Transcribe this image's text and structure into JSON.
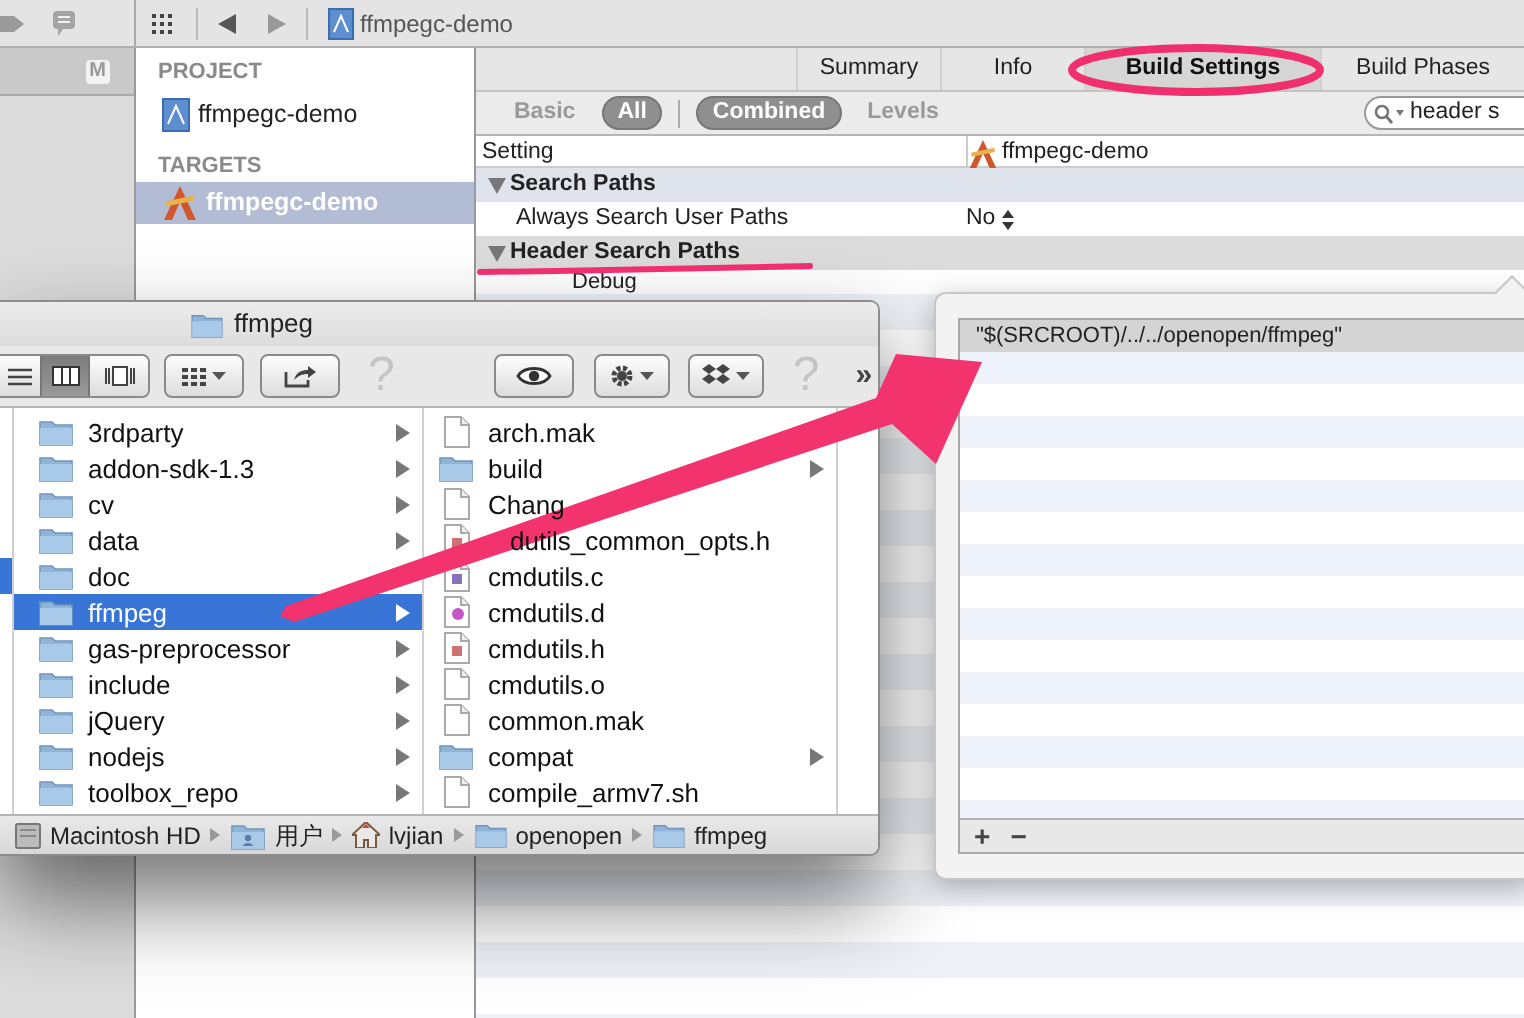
{
  "navigator": {
    "badge": "M"
  },
  "jump_bar": {
    "crumb": "ffmpegc-demo"
  },
  "project_list": [
    {
      "title": "PROJECT",
      "items": [
        {
          "label": "ffmpegc-demo",
          "kind": "project",
          "selected": false
        }
      ]
    },
    {
      "title": "TARGETS",
      "items": [
        {
          "label": "ffmpegc-demo",
          "kind": "target",
          "selected": true
        }
      ]
    }
  ],
  "editor_tabs": [
    {
      "label": "Summary",
      "selected": false
    },
    {
      "label": "Info",
      "selected": false
    },
    {
      "label": "Build Settings",
      "selected": true
    },
    {
      "label": "Build Phases",
      "selected": false
    }
  ],
  "filter": {
    "scope": [
      {
        "label": "Basic",
        "selected": false
      },
      {
        "label": "All",
        "selected": true
      }
    ],
    "display": [
      {
        "label": "Combined",
        "selected": true
      },
      {
        "label": "Levels",
        "selected": false
      }
    ],
    "search": {
      "value": "header s"
    }
  },
  "settings_table": {
    "columns": [
      "Setting",
      "ffmpegc-demo"
    ],
    "rows": [
      {
        "kind": "section",
        "label": "Search Paths",
        "expanded": true
      },
      {
        "kind": "setting",
        "label": "Always Search User Paths",
        "value": "No"
      },
      {
        "kind": "section",
        "label": "Header Search Paths",
        "expanded": true
      },
      {
        "kind": "config",
        "label": "Debug"
      }
    ]
  },
  "finder": {
    "title": "ffmpeg",
    "help": [
      "?",
      "?"
    ],
    "overflow": "»",
    "columns": [
      [
        {
          "label": "3rdparty",
          "kind": "folder",
          "selected": false
        },
        {
          "label": "addon-sdk-1.3",
          "kind": "folder",
          "selected": false
        },
        {
          "label": "cv",
          "kind": "folder",
          "selected": false
        },
        {
          "label": "data",
          "kind": "folder",
          "selected": false
        },
        {
          "label": "doc",
          "kind": "folder",
          "selected": false
        },
        {
          "label": "ffmpeg",
          "kind": "folder",
          "selected": true
        },
        {
          "label": "gas-preprocessor",
          "kind": "folder",
          "selected": false
        },
        {
          "label": "include",
          "kind": "folder",
          "selected": false
        },
        {
          "label": "jQuery",
          "kind": "folder",
          "selected": false
        },
        {
          "label": "nodejs",
          "kind": "folder",
          "selected": false
        },
        {
          "label": "toolbox_repo",
          "kind": "folder",
          "selected": false
        }
      ],
      [
        {
          "label": "arch.mak",
          "kind": "file",
          "selected": false
        },
        {
          "label": "build",
          "kind": "folder",
          "selected": false
        },
        {
          "label": "Chang",
          "kind": "file",
          "selected": false
        },
        {
          "label": "dutils_common_opts.h",
          "kind": "header",
          "selected": false
        },
        {
          "label": "cmdutils.c",
          "kind": "source",
          "selected": false
        },
        {
          "label": "cmdutils.d",
          "kind": "dep",
          "selected": false
        },
        {
          "label": "cmdutils.h",
          "kind": "header",
          "selected": false
        },
        {
          "label": "cmdutils.o",
          "kind": "file",
          "selected": false
        },
        {
          "label": "common.mak",
          "kind": "file",
          "selected": false
        },
        {
          "label": "compat",
          "kind": "folder",
          "selected": false
        },
        {
          "label": "compile_armv7.sh",
          "kind": "file",
          "selected": false
        }
      ]
    ],
    "path": [
      {
        "label": "Macintosh HD",
        "kind": "disk"
      },
      {
        "label": "用户",
        "kind": "users"
      },
      {
        "label": "lvjian",
        "kind": "home"
      },
      {
        "label": "openopen",
        "kind": "folder"
      },
      {
        "label": "ffmpeg",
        "kind": "folder"
      }
    ]
  },
  "popup": {
    "paths": [
      {
        "value": "\"$(SRCROOT)/../../openopen/ffmpeg\"",
        "selected": true
      }
    ],
    "add": "+",
    "remove": "−"
  }
}
